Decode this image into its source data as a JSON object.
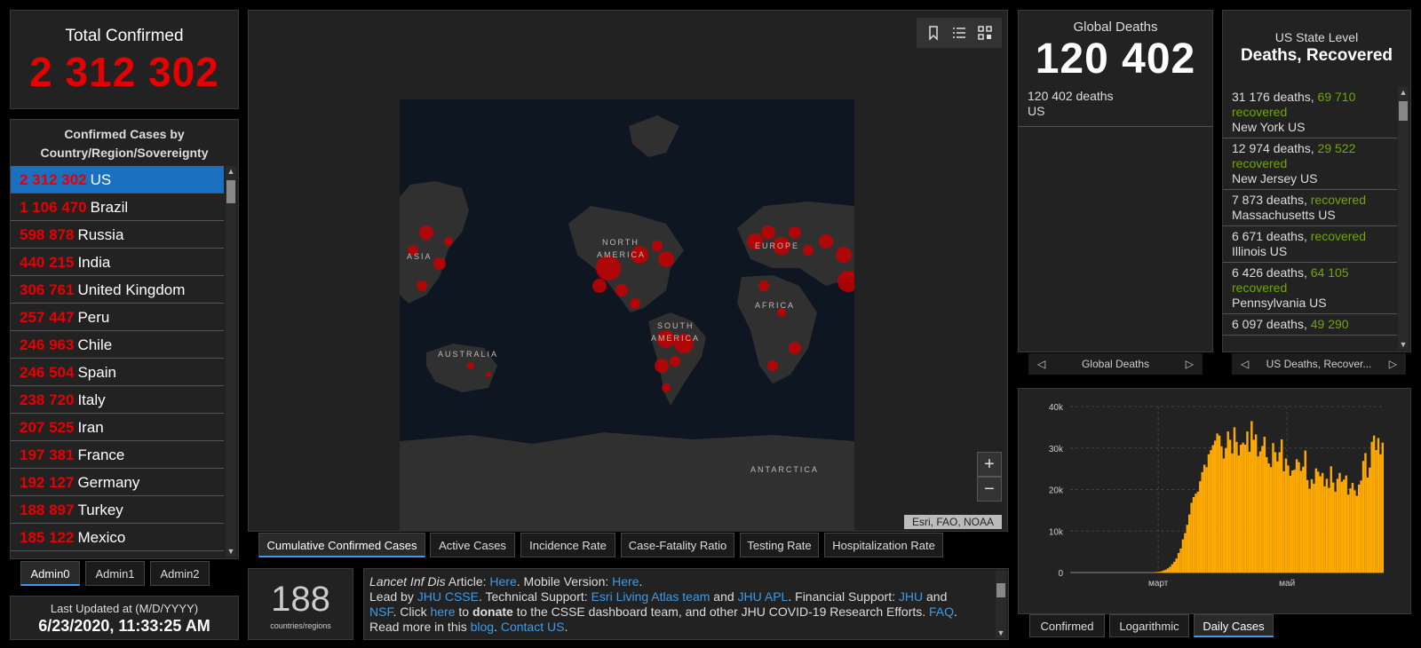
{
  "total": {
    "label": "Total Confirmed",
    "value": "2 312 302"
  },
  "country_panel": {
    "title": "Confirmed Cases by Country/Region/Sovereignty",
    "rows": [
      {
        "count": "2 312 302",
        "name": "US"
      },
      {
        "count": "1 106 470",
        "name": "Brazil"
      },
      {
        "count": "598 878",
        "name": "Russia"
      },
      {
        "count": "440 215",
        "name": "India"
      },
      {
        "count": "306 761",
        "name": "United Kingdom"
      },
      {
        "count": "257 447",
        "name": "Peru"
      },
      {
        "count": "246 963",
        "name": "Chile"
      },
      {
        "count": "246 504",
        "name": "Spain"
      },
      {
        "count": "238 720",
        "name": "Italy"
      },
      {
        "count": "207 525",
        "name": "Iran"
      },
      {
        "count": "197 381",
        "name": "France"
      },
      {
        "count": "192 127",
        "name": "Germany"
      },
      {
        "count": "188 897",
        "name": "Turkey"
      },
      {
        "count": "185 122",
        "name": "Mexico"
      }
    ]
  },
  "admin_tabs": [
    "Admin0",
    "Admin1",
    "Admin2"
  ],
  "updated": {
    "label": "Last Updated at (M/D/YYYY)",
    "value": "6/23/2020, 11:33:25 AM"
  },
  "map": {
    "labels": [
      "NORTH",
      "AMERICA",
      "SOUTH",
      "AMERICA",
      "EUROPE",
      "AFRICA",
      "ASIA",
      "AUSTRALIA",
      "ANTARCTICA"
    ],
    "attribution": "Esri, FAO, NOAA",
    "zoom_in": "+",
    "zoom_out": "−",
    "tools": [
      "bookmark-icon",
      "list-icon",
      "qr-grid-icon"
    ],
    "tabs": [
      "Cumulative Confirmed Cases",
      "Active Cases",
      "Incidence Rate",
      "Case-Fatality Ratio",
      "Testing Rate",
      "Hospitalization Rate"
    ],
    "colors": {
      "ocean": "#0e1621",
      "land": "#303030",
      "bubble": "#c60000"
    }
  },
  "count": {
    "value": "188",
    "label": "countries/regions"
  },
  "info": {
    "p1": "Lancet Inf Dis",
    "p2": " Article: ",
    "p3": "Here",
    "p4": ". Mobile Version: ",
    "p5": "Here",
    "p6": ".",
    "p7": "Lead by ",
    "p8": "JHU CSSE",
    "p9": ". Technical Support: ",
    "p10": "Esri Living Atlas team",
    "p11": " and ",
    "p12": "JHU APL",
    "p13": ". Financial Support: ",
    "p14": "JHU",
    "p15": " and",
    "p16": "NSF",
    "p17": ". Click ",
    "p18": "here",
    "p19": " to ",
    "p20": "donate",
    "p21": " to the CSSE dashboard team, and other JHU COVID-19 Research Efforts. ",
    "p22": "FAQ",
    "p23": ". Read more in this ",
    "p24": "blog",
    "p25": ". ",
    "p26": "Contact US",
    "p27": "."
  },
  "global_deaths": {
    "title": "Global Deaths",
    "value": "120 402",
    "entry_value": "120 402",
    "entry_suffix": " deaths",
    "entry_name": "US",
    "pager": "Global Deaths"
  },
  "us_state": {
    "title1": "US State Level",
    "title2": "Deaths, Recovered",
    "rows": [
      {
        "deaths": "31 176 deaths,",
        "recovered_num": "69 710",
        "recovered": "recovered",
        "state": "New York US"
      },
      {
        "deaths": "12 974 deaths,",
        "recovered_num": "29 522",
        "recovered": "recovered",
        "state": "New Jersey US"
      },
      {
        "deaths": "7 873 deaths,",
        "recovered_num": "",
        "recovered": "recovered",
        "state": "Massachusetts US"
      },
      {
        "deaths": "6 671 deaths,",
        "recovered_num": "",
        "recovered": "recovered",
        "state": "Illinois US"
      },
      {
        "deaths": "6 426 deaths,",
        "recovered_num": "64 105",
        "recovered": "recovered",
        "state": "Pennsylvania US"
      },
      {
        "deaths": "6 097 deaths,",
        "recovered_num": "49 290",
        "recovered": "",
        "state": ""
      }
    ],
    "pager": "US Deaths, Recover..."
  },
  "chart_tabs": [
    "Confirmed",
    "Logarithmic",
    "Daily Cases"
  ],
  "chart_data": {
    "type": "bar",
    "yticks": [
      "0",
      "10k",
      "20k",
      "30k",
      "40k"
    ],
    "ylim": [
      0,
      40000
    ],
    "xticks": [
      "март",
      "май"
    ],
    "start_month_label": "",
    "color": "#ffaa00",
    "values": [
      0,
      0,
      0,
      0,
      0,
      0,
      0,
      0,
      0,
      0,
      0,
      0,
      0,
      0,
      0,
      0,
      0,
      0,
      0,
      0,
      0,
      0,
      0,
      0,
      0,
      0,
      0,
      0,
      0,
      0,
      0,
      0,
      0,
      0,
      0,
      0,
      0,
      0,
      0,
      100,
      150,
      200,
      300,
      500,
      700,
      1000,
      1400,
      2000,
      2600,
      3400,
      4700,
      5800,
      8000,
      9500,
      11500,
      14000,
      16800,
      18200,
      19000,
      19500,
      22000,
      24200,
      26000,
      25400,
      28500,
      29500,
      30700,
      31800,
      33500,
      33000,
      30400,
      27500,
      30000,
      34000,
      32000,
      28700,
      35000,
      31500,
      28200,
      30800,
      31300,
      30800,
      34000,
      29100,
      36500,
      32000,
      33300,
      28000,
      29200,
      30500,
      32700,
      27800,
      26300,
      25400,
      31200,
      29000,
      26800,
      29000,
      32100,
      24400,
      27500,
      25800,
      23300,
      24600,
      24800,
      27300,
      26600,
      24500,
      25500,
      29400,
      22300,
      20200,
      22500,
      21400,
      25100,
      24300,
      23200,
      24000,
      20800,
      22600,
      20400,
      25600,
      21700,
      19500,
      22600,
      24000,
      21900,
      22400,
      23400,
      18800,
      20300,
      21600,
      19800,
      18500,
      21200,
      22200,
      26900,
      28800,
      22900,
      25300,
      31500,
      33000,
      29500,
      32400,
      28500,
      31300
    ]
  }
}
